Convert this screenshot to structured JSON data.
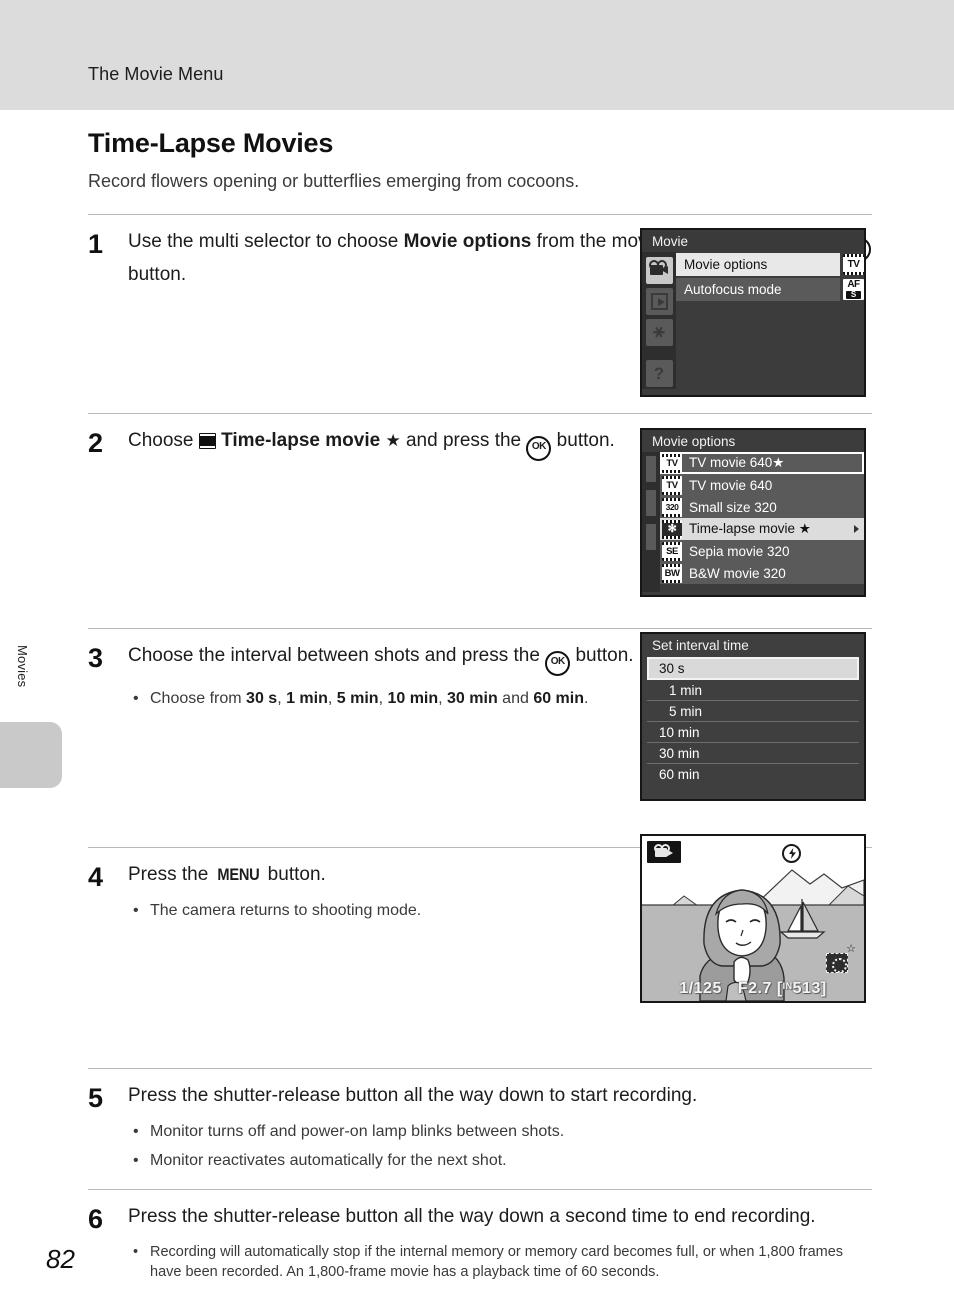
{
  "header": {
    "title": "The Movie Menu"
  },
  "sidebar": {
    "section_label": "Movies"
  },
  "page": {
    "number": "82"
  },
  "article": {
    "title": "Time-Lapse Movies",
    "lede": "Record flowers opening or butterflies emerging from cocoons."
  },
  "steps": [
    {
      "num": "1",
      "text_1": "Use the multi selector to choose ",
      "bold_1": "Movie options",
      "text_2": " from the movie menu, and press the ",
      "ok": "OK",
      "text_3": " button."
    },
    {
      "num": "2",
      "text_1": "Choose ",
      "bold_1": "Time-lapse movie",
      "star": "★",
      "text_2": " and press the ",
      "ok": "OK",
      "text_3": " button."
    },
    {
      "num": "3",
      "text_1": "Choose the interval between shots and press the ",
      "ok": "OK",
      "text_2": " button.",
      "bullet_prefix": "Choose from ",
      "options": [
        "30 s",
        "1 min",
        "5 min",
        "10 min",
        "30 min",
        "60 min"
      ],
      "bullet_joiner_and": " and ",
      "bullet_suffix": "."
    },
    {
      "num": "4",
      "text_1": "Press the ",
      "menu": "MENU",
      "text_2": " button.",
      "bullets": [
        "The camera returns to shooting mode."
      ]
    },
    {
      "num": "5",
      "text_1": "Press the shutter-release button all the way down to start recording.",
      "bullets": [
        "Monitor turns off and power-on lamp blinks between shots.",
        "Monitor reactivates automatically for the next shot."
      ]
    },
    {
      "num": "6",
      "text_1": "Press the shutter-release button all the way down a second time to end recording.",
      "bullets": [
        "Recording will automatically stop if the internal memory or memory card becomes full, or when 1,800 frames have been recorded. An 1,800-frame movie has a playback time of 60 seconds."
      ]
    }
  ],
  "screens": {
    "movie_menu": {
      "title": "Movie",
      "rows": [
        {
          "label": "Movie options",
          "selected": true,
          "badge_top": "TV",
          "badge_bottom": "",
          "badge_kind": "film"
        },
        {
          "label": "Autofocus mode",
          "selected": false,
          "badge_top": "AF",
          "badge_bottom": "S",
          "badge_kind": "plain"
        }
      ],
      "sidebar_icons": [
        "movie-camera-icon",
        "playback-icon",
        "wrench-icon",
        "help-icon"
      ],
      "help_glyph": "?",
      "wrench_glyph": "⑂"
    },
    "movie_options": {
      "title": "Movie options",
      "items": [
        {
          "label": "TV movie 640★",
          "icon": "tv-star-icon",
          "icon_text": "TV",
          "highlighted": true,
          "selected": false,
          "arrow": false
        },
        {
          "label": "TV movie 640",
          "icon": "tv-icon",
          "icon_text": "TV",
          "highlighted": false,
          "selected": false,
          "arrow": false
        },
        {
          "label": "Small size 320",
          "icon": "size-320-icon",
          "icon_text": "320",
          "highlighted": false,
          "selected": false,
          "arrow": false
        },
        {
          "label": "Time-lapse movie ★",
          "icon": "time-lapse-icon",
          "icon_text": "✻",
          "highlighted": false,
          "selected": true,
          "arrow": true
        },
        {
          "label": "Sepia movie 320",
          "icon": "sepia-icon",
          "icon_text": "SE",
          "highlighted": false,
          "selected": false,
          "arrow": false
        },
        {
          "label": "B&W movie 320",
          "icon": "bw-icon",
          "icon_text": "BW",
          "highlighted": false,
          "selected": false,
          "arrow": false
        }
      ]
    },
    "set_interval": {
      "title": "Set interval time",
      "items": [
        {
          "label": "30 s",
          "selected": true,
          "indent": false
        },
        {
          "label": "1 min",
          "selected": false,
          "indent": true
        },
        {
          "label": "5 min",
          "selected": false,
          "indent": true
        },
        {
          "label": "10 min",
          "selected": false,
          "indent": false
        },
        {
          "label": "30 min",
          "selected": false,
          "indent": false
        },
        {
          "label": "60 min",
          "selected": false,
          "indent": false
        }
      ]
    },
    "live_view": {
      "mode_icon": "movie-mode-icon",
      "flash_icon": "flash-off-icon",
      "timelapse_icon": "time-lapse-icon",
      "star": "☆",
      "shutter_speed": "1/125",
      "aperture": "F2.7",
      "memory_mark": "IN",
      "frames_remaining": "513",
      "bracket_open": "[",
      "bracket_close": "]"
    }
  }
}
